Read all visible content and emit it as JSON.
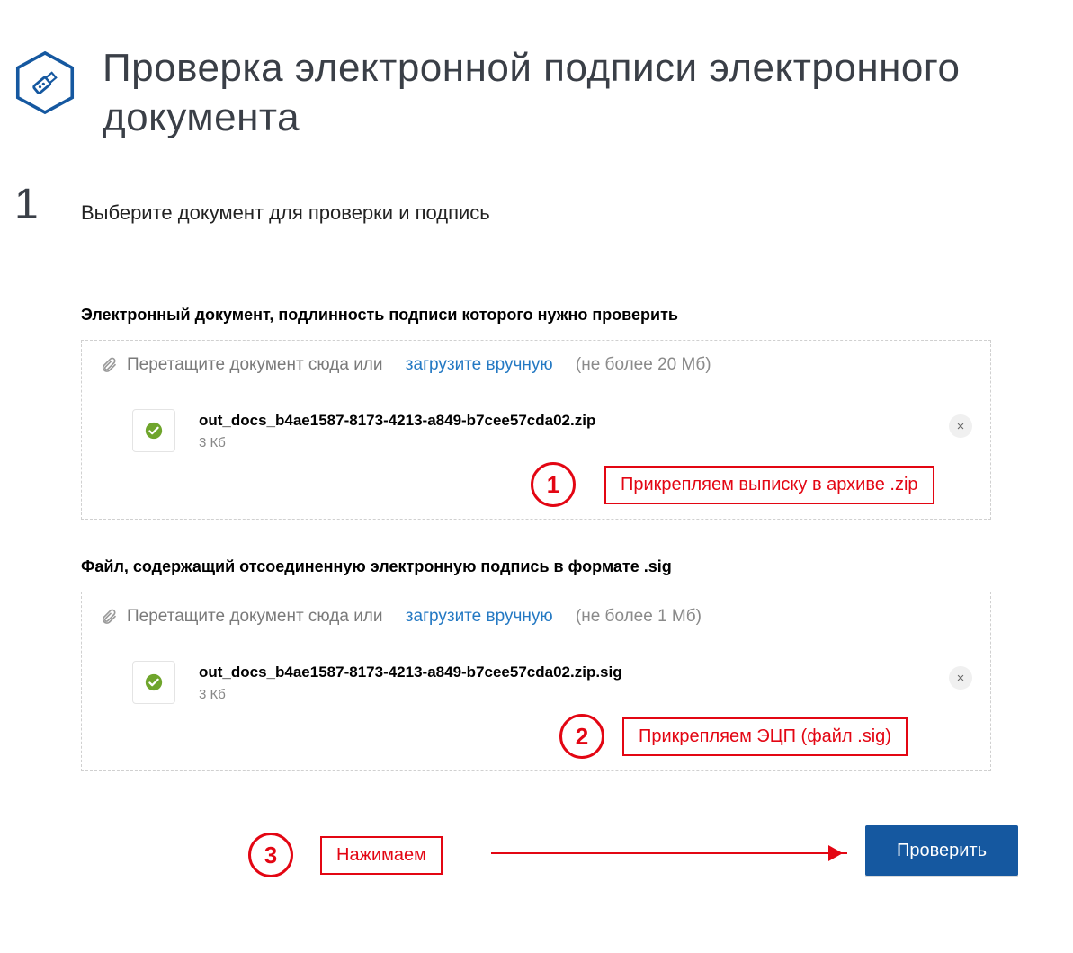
{
  "header": {
    "title": "Проверка электронной подписи электронного документа"
  },
  "step": {
    "number": "1",
    "heading": "Выберите документ для проверки и подпись"
  },
  "upload_doc": {
    "label": "Электронный документ, подлинность подписи которого нужно проверить",
    "drag_text": "Перетащите документ сюда или",
    "link_text": "загрузите вручную",
    "limit_text": "(не более 20 Мб)",
    "file": {
      "name": "out_docs_b4ae1587-8173-4213-a849-b7cee57cda02.zip",
      "size": "3 Кб"
    }
  },
  "upload_sig": {
    "label": "Файл, содержащий отсоединенную электронную подпись в формате .sig",
    "drag_text": "Перетащите документ сюда или",
    "link_text": "загрузите вручную",
    "limit_text": "(не более 1 Мб)",
    "file": {
      "name": "out_docs_b4ae1587-8173-4213-a849-b7cee57cda02.zip.sig",
      "size": "3 Кб"
    }
  },
  "annotations": {
    "a1": {
      "num": "1",
      "text": "Прикрепляем выписку в архиве .zip"
    },
    "a2": {
      "num": "2",
      "text": "Прикрепляем ЭЦП (файл .sig)"
    },
    "a3": {
      "num": "3",
      "text": "Нажимаем"
    }
  },
  "verify_button": "Проверить"
}
